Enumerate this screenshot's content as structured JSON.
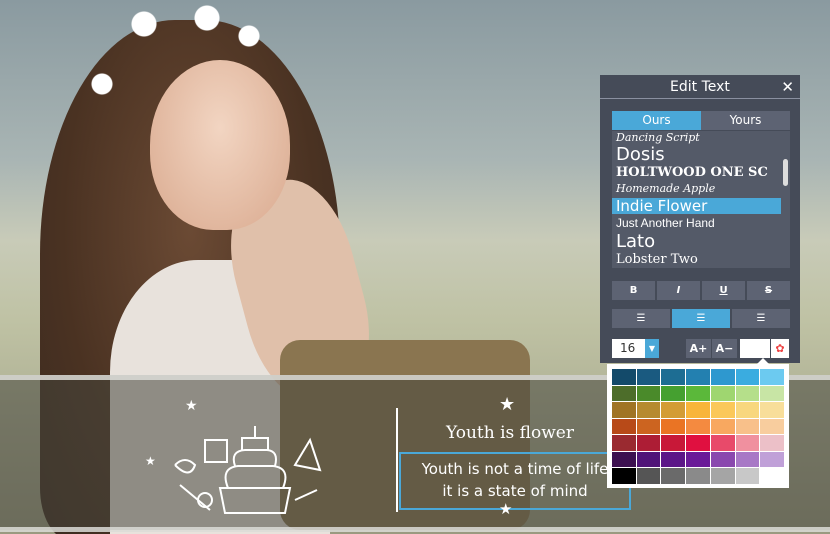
{
  "overlay": {
    "title": "Youth is flower",
    "body_lines": [
      "Youth is not a time of life",
      "it is a state of mind"
    ]
  },
  "panel": {
    "title": "Edit Text",
    "close_icon": "✕",
    "tabs": [
      {
        "label": "Ours",
        "active": true
      },
      {
        "label": "Yours",
        "active": false
      }
    ],
    "fonts": [
      {
        "label": "Dancing Script",
        "selected": false
      },
      {
        "label": "Dosis",
        "selected": false
      },
      {
        "label": "HOLTWOOD ONE SC",
        "selected": false
      },
      {
        "label": "Homemade Apple",
        "selected": false
      },
      {
        "label": "Indie Flower",
        "selected": true
      },
      {
        "label": "Just Another Hand",
        "selected": false
      },
      {
        "label": "Lato",
        "selected": false
      },
      {
        "label": "Lobster Two",
        "selected": false
      }
    ],
    "style_buttons": [
      "B",
      "I",
      "U",
      "S"
    ],
    "align": [
      "align-left",
      "align-center",
      "align-right"
    ],
    "align_active": "align-center",
    "font_size": "16",
    "increase_label": "A+",
    "decrease_label": "A−",
    "current_color": "#ffffff"
  },
  "palette": [
    "#134a6a",
    "#1a5a80",
    "#1d6d93",
    "#2380b0",
    "#2e98cf",
    "#3aace0",
    "#6ccaf0",
    "#4d6d2a",
    "#4a8a2a",
    "#45a030",
    "#5bb83a",
    "#9fd670",
    "#b5df8a",
    "#c8e5a5",
    "#a07424",
    "#b68a30",
    "#d39c35",
    "#f8b53a",
    "#fbc85a",
    "#f8d77e",
    "#f8de9a",
    "#b84a18",
    "#cc6420",
    "#ea7424",
    "#f48a40",
    "#f8a860",
    "#f8c08a",
    "#f8cd9e",
    "#9a2a30",
    "#ad1d35",
    "#c81838",
    "#e01040",
    "#e84a6a",
    "#f0909f",
    "#ecc0c8",
    "#3c1050",
    "#501478",
    "#5c1688",
    "#6a1a98",
    "#8a48ae",
    "#a878c6",
    "#c0a0d8",
    "#000000",
    "#555555",
    "#6a6a6a",
    "#8a8a8a",
    "#a5a5a5",
    "#c8c8c8",
    "#ffffff"
  ]
}
